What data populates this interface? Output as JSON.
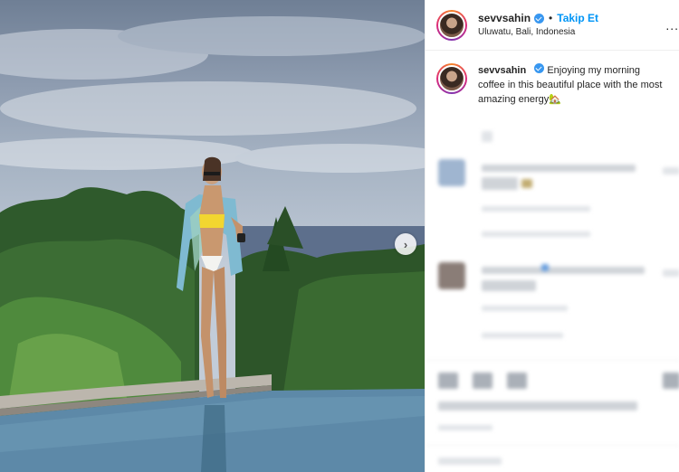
{
  "post": {
    "username": "sevvsahin",
    "separator": "•",
    "follow_label": "Takip Et",
    "location": "Uluwatu, Bali, Indonesia",
    "more_label": "..."
  },
  "caption": {
    "username": "sevvsahin",
    "text": "Enjoying my morning coffee in this beautiful place with the most amazing energy",
    "emoji": "🏡"
  },
  "icons": {
    "next": "chevron-right-icon",
    "verified": "verified-badge-icon"
  },
  "colors": {
    "follow": "#0095f6",
    "verified": "#3897f0",
    "pool": "#5d89a8",
    "bikini": "#f2d630"
  }
}
